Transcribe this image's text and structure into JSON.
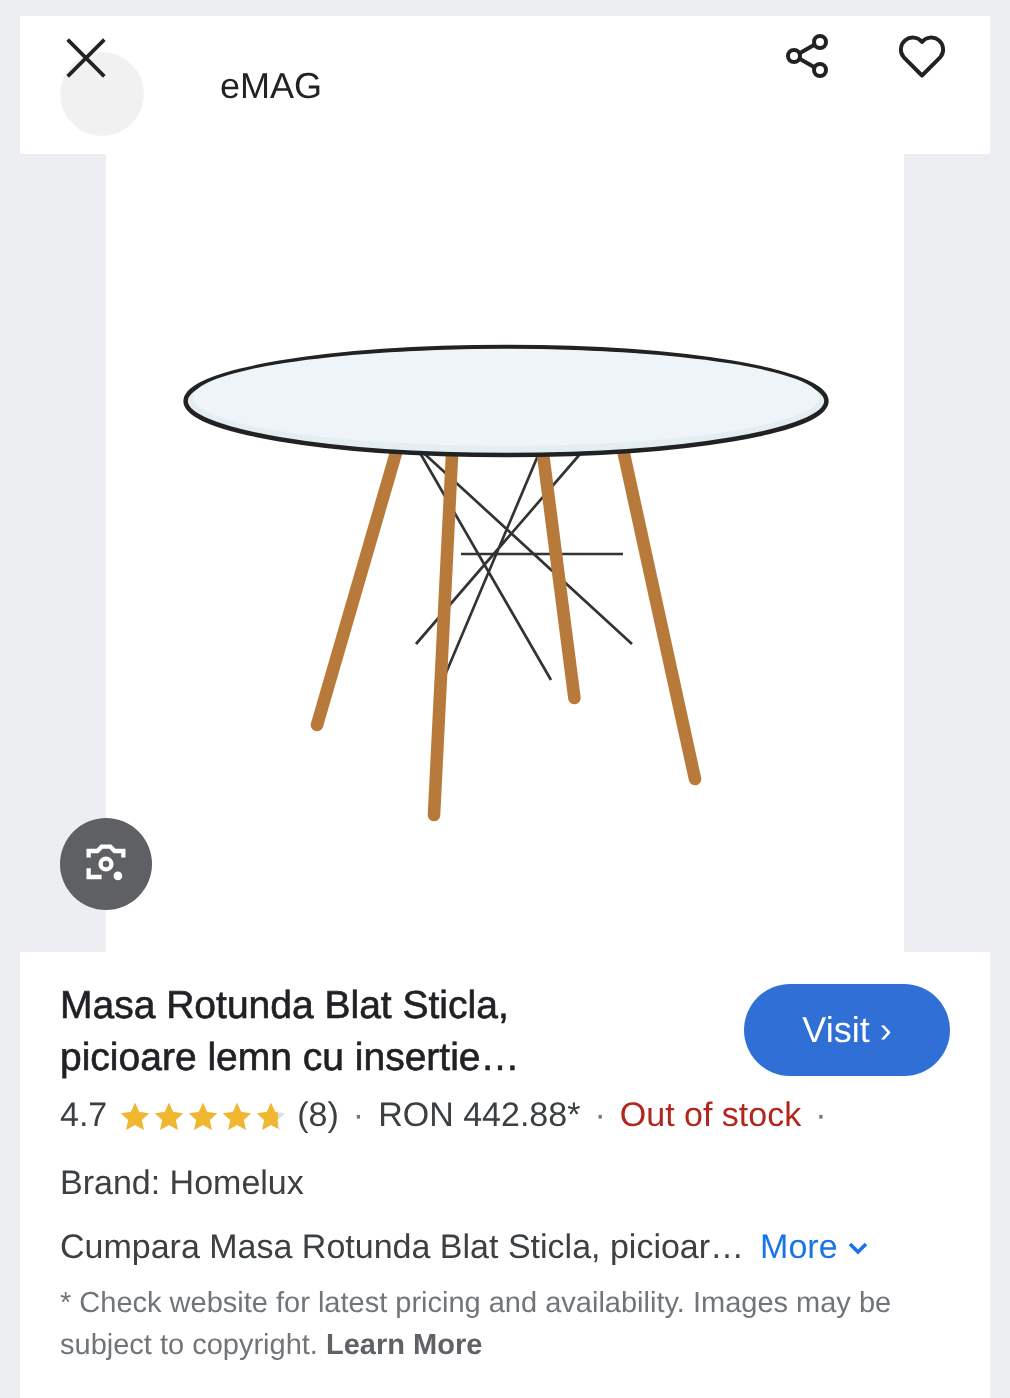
{
  "header": {
    "store": "eMAG"
  },
  "product": {
    "title": "Masa Rotunda Blat Sticla, picioare lemn cu insertie…",
    "visit_button": "Visit ›",
    "rating": "4.7",
    "stars": 4.7,
    "reviews": "(8)",
    "price": "RON 442.88*",
    "availability": "Out of stock",
    "separator": "·",
    "brand": "Brand: Homelux",
    "description": "Cumpara Masa Rotunda Blat Sticla, picioar…",
    "more_link": "More",
    "disclaimer": "* Check website for latest pricing and availability. Images may be subject to copyright.",
    "learn_more": "Learn More"
  }
}
